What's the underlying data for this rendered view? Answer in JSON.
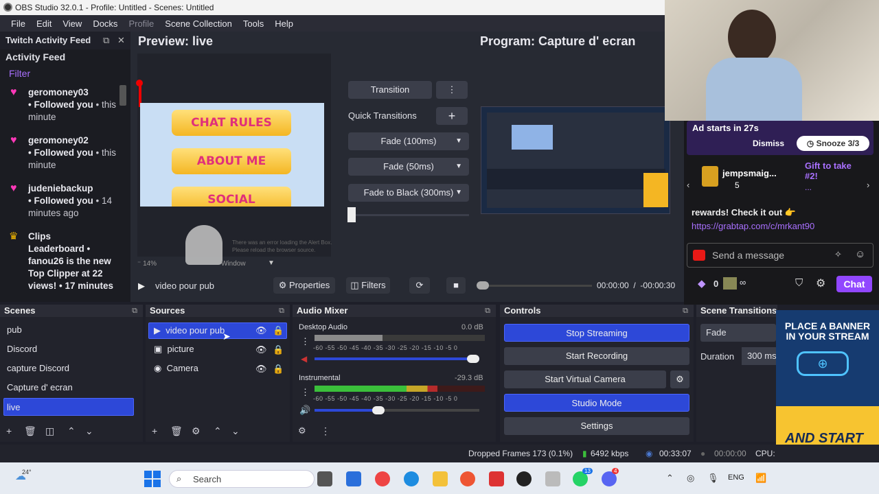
{
  "window": {
    "title": "OBS Studio 32.0.1 - Profile: Untitled - Scenes: Untitled"
  },
  "menu": [
    "File",
    "Edit",
    "View",
    "Docks",
    "Profile",
    "Scene Collection",
    "Tools",
    "Help"
  ],
  "feed": {
    "dock_title": "Twitch Activity Feed",
    "title": "Activity Feed",
    "filter": "Filter",
    "items": [
      {
        "name": "geromoney03",
        "action": "Followed you",
        "time": "• this minute"
      },
      {
        "name": "geromoney02",
        "action": "Followed you",
        "time": "• this minute"
      },
      {
        "name": "judeniebackup",
        "action": "Followed you",
        "time": "• 14 minutes ago"
      }
    ],
    "clips": {
      "title": "Clips",
      "line1": "Leaderboard •",
      "text": "fanou26 is the new Top Clipper at 22 views! • 17 minutes"
    }
  },
  "preview": {
    "title": "Preview: live",
    "banners": [
      "CHAT RULES",
      "ABOUT ME",
      "SOCIAL"
    ],
    "strip_zoom": "14%",
    "strip_window": "Window",
    "error_text": "There was an error loading the Alert Box. Please reload the browser source."
  },
  "program": {
    "title": "Program: Capture d' ecran"
  },
  "transitions": {
    "transition_label": "Transition",
    "quick_label": "Quick Transitions",
    "items": [
      "Fade (100ms)",
      "Fade (50ms)",
      "Fade to Black (300ms)"
    ]
  },
  "media": {
    "source_name": "video pour pub",
    "properties": "Properties",
    "filters": "Filters",
    "time_current": "00:00:00",
    "time_sep": "/",
    "time_remaining": "-00:00:30"
  },
  "twitch": {
    "ad_text": "Ad starts in 27s",
    "dismiss": "Dismiss",
    "snooze": "Snooze 3/3",
    "gift_user": "jempsmaig...",
    "gift_count": "5",
    "gift_promo": "Gift to take #2!",
    "gift_more": "...",
    "chat_line": "rewards! Check it out 👉",
    "chat_link": "https://grabtap.com/c/mrkant90",
    "send_placeholder": "Send a message",
    "points": "0",
    "infinity": "∞",
    "chat_button": "Chat",
    "accent": "#9147ff"
  },
  "scenes": {
    "title": "Scenes",
    "items": [
      "pub",
      "Discord",
      "capture Discord",
      "Capture d' ecran",
      "live"
    ],
    "selected": "live"
  },
  "sources": {
    "title": "Sources",
    "items": [
      "video pour pub",
      "picture",
      "Camera"
    ]
  },
  "audio": {
    "title": "Audio Mixer",
    "channels": [
      {
        "name": "Desktop Audio",
        "db": "0.0 dB",
        "level": 0.4,
        "volume": 1.0
      },
      {
        "name": "Instrumental",
        "db": "-29.3 dB",
        "level": 0.72,
        "volume": 0.38
      }
    ],
    "scale": [
      "-60",
      "-55",
      "-50",
      "-45",
      "-40",
      "-35",
      "-30",
      "-25",
      "-20",
      "-15",
      "-10",
      "-5",
      "0"
    ]
  },
  "controls": {
    "title": "Controls",
    "buttons": [
      "Stop Streaming",
      "Start Recording",
      "Start Virtual Camera",
      "Studio Mode",
      "Settings"
    ]
  },
  "scene_transitions": {
    "title": "Scene Transitions",
    "value": "Fade",
    "duration_label": "Duration",
    "duration_value": "300 ms"
  },
  "status": {
    "dropped": "Dropped Frames 173 (0.1%)",
    "kbps": "6492 kbps",
    "stream_time": "00:33:07",
    "rec_time": "00:00:00",
    "cpu": "CPU:"
  },
  "ad_banner": {
    "line1": "PLACE A BANNER IN YOUR STREAM",
    "line2": "AND START EARNING TODAY!"
  },
  "taskbar": {
    "weather": "24°",
    "search": "Search",
    "lang": "ENG",
    "badge1": "13",
    "badge2": "4"
  }
}
